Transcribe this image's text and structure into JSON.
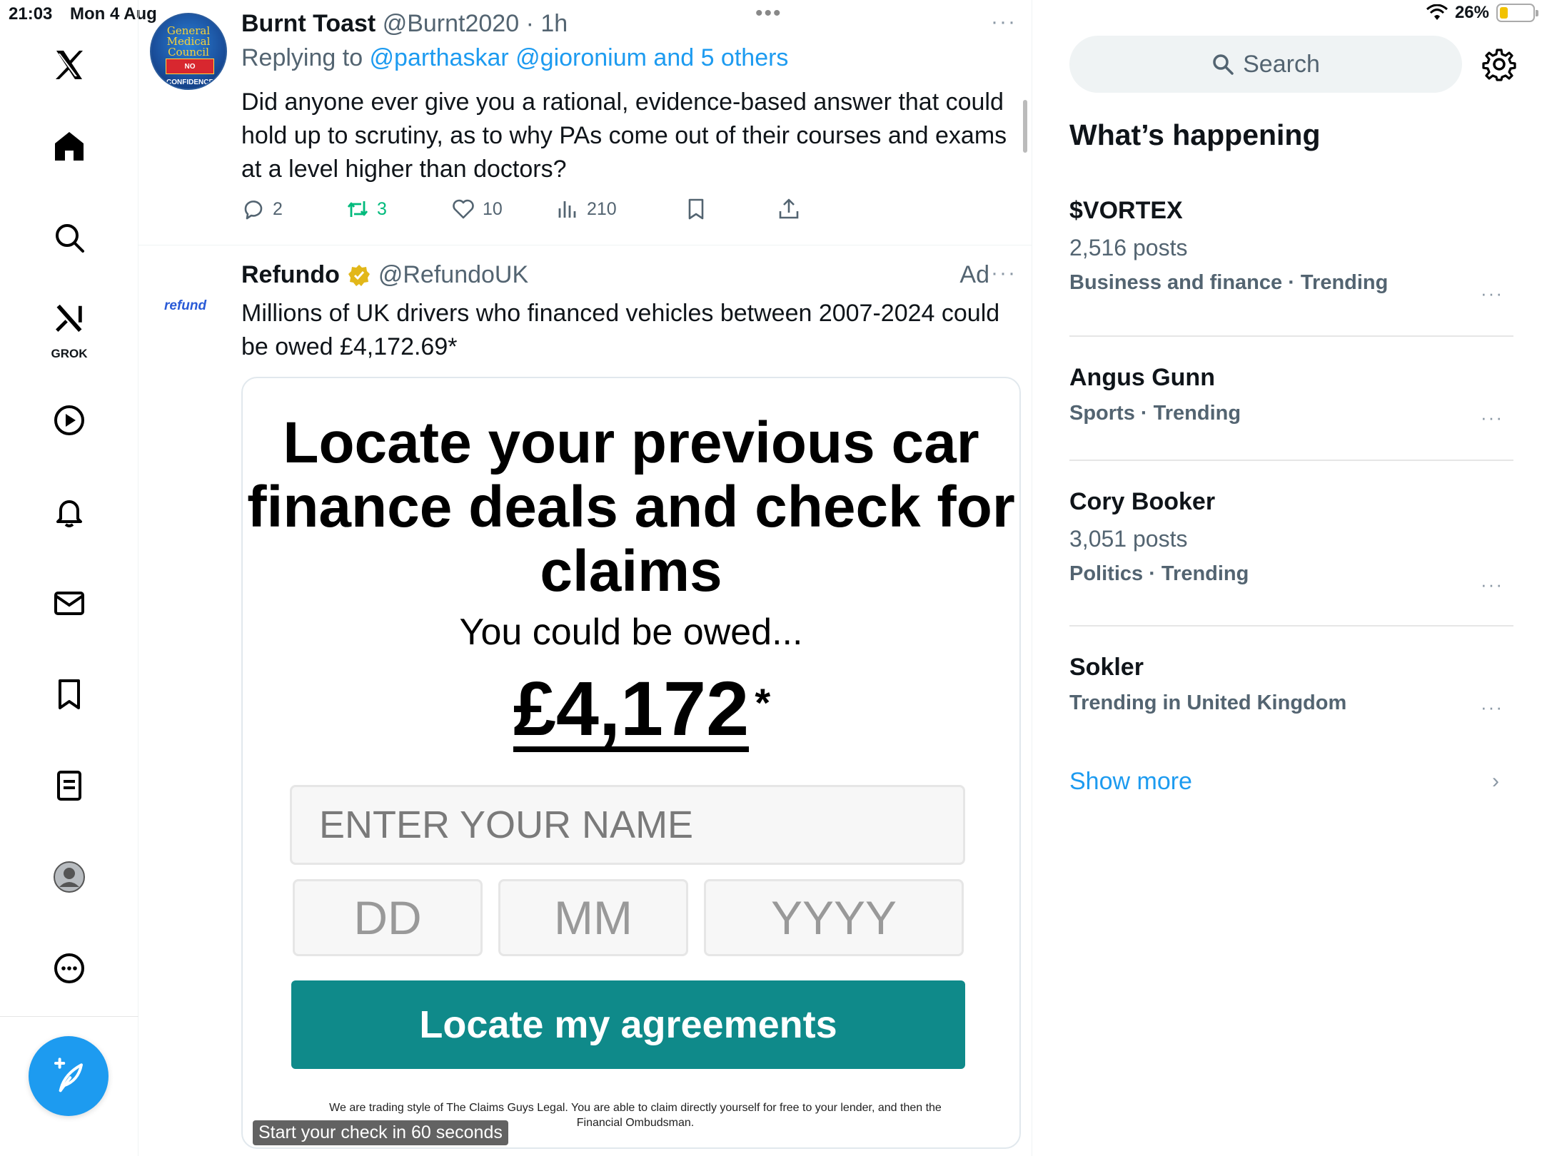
{
  "status": {
    "time": "21:03",
    "date": "Mon 4 Aug",
    "battery": "26%",
    "battery_level": 0.26
  },
  "nav": {
    "items": [
      "x-logo",
      "home",
      "explore",
      "grok",
      "video",
      "notifications",
      "messages",
      "bookmarks",
      "lists",
      "profile",
      "more"
    ],
    "grok_label": "GROK"
  },
  "tweet": {
    "name": "Burnt Toast",
    "handle": "@Burnt2020",
    "time": "· 1h",
    "more": "···",
    "replying_prefix": "Replying to ",
    "replying_users": "@parthaskar @gioronium and 5 others",
    "body": "Did anyone ever give you a rational, evidence-based answer that could hold up to scrutiny, as to why PAs come out of their courses and exams at a level higher than doctors?",
    "avatar_text": "General Medical Council",
    "avatar_band": "NO CONFIDENCE",
    "replies": "2",
    "retweets": "3",
    "likes": "10",
    "views": "210"
  },
  "ad": {
    "avatar_text": "refund",
    "name": "Refundo",
    "handle": "@RefundoUK",
    "tag": "Ad",
    "more": "···",
    "body": "Millions of UK drivers who financed vehicles between 2007-2024 could be owed £4,172.69*",
    "card": {
      "headline": "Locate your previous car finance deals and check for claims",
      "sub": "You could be owed...",
      "amount": "£4,172",
      "star": "*",
      "name_placeholder": "ENTER YOUR NAME",
      "dd": "DD",
      "mm": "MM",
      "yyyy": "YYYY",
      "button": "Locate my agreements",
      "fine_print": "We are trading style of The Claims Guys Legal. You are able to claim directly yourself for free to your lender, and then the Financial Ombudsman.",
      "overlay": "Start your check in 60 seconds"
    }
  },
  "sidebar": {
    "search_placeholder": "Search",
    "heading": "What’s happening",
    "trends": [
      {
        "title": "$VORTEX",
        "posts": "2,516 posts",
        "category": "Business and finance · Trending"
      },
      {
        "title": "Angus Gunn",
        "posts": "",
        "category": "Sports · Trending"
      },
      {
        "title": "Cory Booker",
        "posts": "3,051 posts",
        "category": "Politics · Trending"
      },
      {
        "title": "Sokler",
        "posts": "",
        "category": "Trending in United Kingdom"
      }
    ],
    "trend_more": "···",
    "show_more": "Show more",
    "chevron": "›"
  },
  "colors": {
    "accent": "#1d9bf0",
    "retweet_green": "#00ba7c",
    "ad_button": "#0f8a8a",
    "battery": "#f2c200"
  }
}
